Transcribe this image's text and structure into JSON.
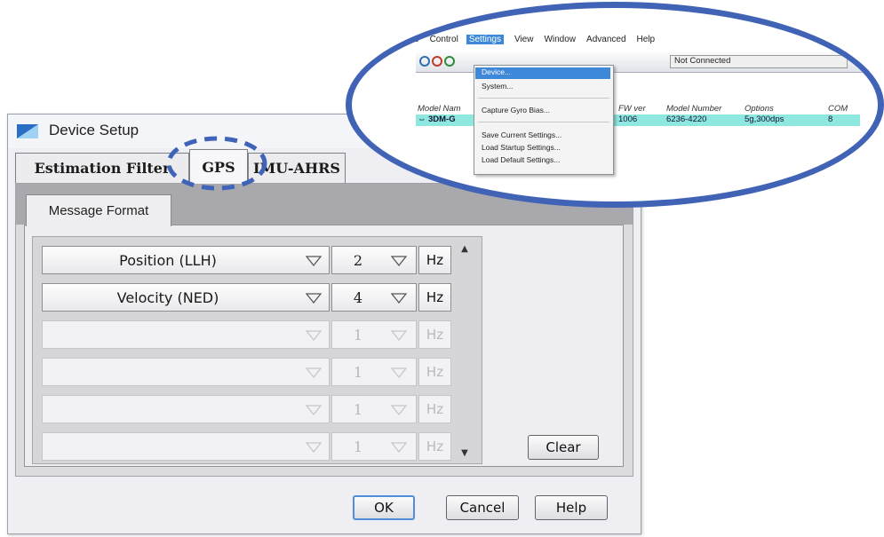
{
  "dialog": {
    "title": "Device Setup",
    "tabs": [
      {
        "label": "Estimation Filter"
      },
      {
        "label": "GPS",
        "active": true
      },
      {
        "label": "IMU-AHRS"
      }
    ],
    "subtab": "Message Format",
    "rows": [
      {
        "format": "Position (LLH)",
        "rate": "2",
        "unit": "Hz",
        "enabled": true
      },
      {
        "format": "Velocity (NED)",
        "rate": "4",
        "unit": "Hz",
        "enabled": true
      },
      {
        "format": "",
        "rate": "1",
        "unit": "Hz",
        "enabled": false
      },
      {
        "format": "",
        "rate": "1",
        "unit": "Hz",
        "enabled": false
      },
      {
        "format": "",
        "rate": "1",
        "unit": "Hz",
        "enabled": false
      },
      {
        "format": "",
        "rate": "1",
        "unit": "Hz",
        "enabled": false
      }
    ],
    "clear_label": "Clear",
    "ok_label": "OK",
    "cancel_label": "Cancel",
    "help_label": "Help"
  },
  "zoom": {
    "menubar": [
      "e",
      "Control",
      "Settings",
      "View",
      "Window",
      "Advanced",
      "Help"
    ],
    "status": "Not Connected",
    "help_icon": "?",
    "columns": [
      "Model Nam",
      "FW ver",
      "Model Number",
      "Options",
      "COM"
    ],
    "device": {
      "name": "3DM-G",
      "fw": "1006",
      "model": "6236-4220",
      "options": "5g,300dps",
      "com": "8"
    },
    "settings_menu": [
      "Device...",
      "System...",
      "Capture Gyro Bias...",
      "Save Current Settings...",
      "Load Startup Settings...",
      "Load Default Settings..."
    ]
  },
  "colors": {
    "highlight": "#4163b6",
    "menu_select": "#3d88d9",
    "device_row": "#8ee8e0",
    "default_button": "#4f8fd8"
  }
}
